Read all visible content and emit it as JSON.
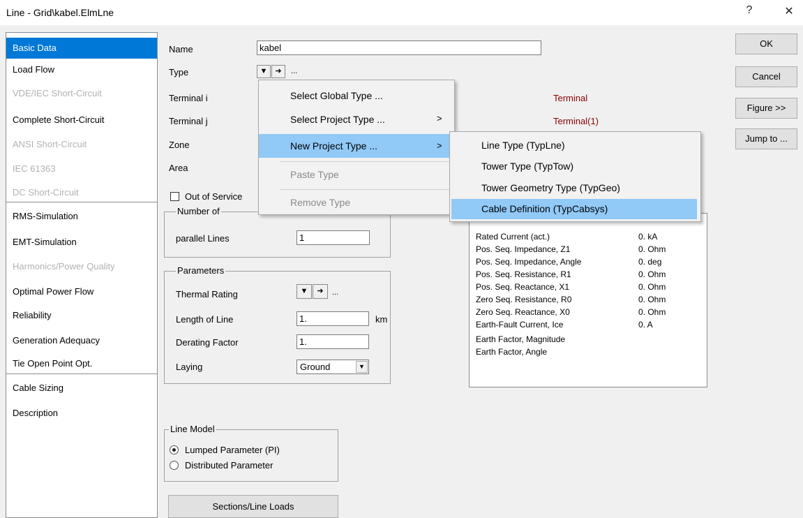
{
  "window": {
    "title": "Line - Grid\\kabel.ElmLne",
    "help_glyph": "?",
    "close_glyph": "✕"
  },
  "sidebar": {
    "items": [
      {
        "label": "Basic Data"
      },
      {
        "label": "Load Flow"
      },
      {
        "label": "VDE/IEC Short-Circuit"
      },
      {
        "label": "Complete Short-Circuit"
      },
      {
        "label": "ANSI Short-Circuit"
      },
      {
        "label": "IEC 61363"
      },
      {
        "label": "DC Short-Circuit"
      },
      {
        "label": "RMS-Simulation"
      },
      {
        "label": "EMT-Simulation"
      },
      {
        "label": "Harmonics/Power Quality"
      },
      {
        "label": "Optimal Power Flow"
      },
      {
        "label": "Reliability"
      },
      {
        "label": "Generation Adequacy"
      },
      {
        "label": "Tie Open Point Opt."
      },
      {
        "label": "Cable Sizing"
      },
      {
        "label": "Description"
      }
    ]
  },
  "form": {
    "name_label": "Name",
    "name_value": "kabel",
    "type_label": "Type",
    "terminal_i_label": "Terminal i",
    "terminal_j_label": "Terminal j",
    "zone_label": "Zone",
    "area_label": "Area",
    "terminal_i_value": "Terminal",
    "terminal_j_value": "Terminal(1)",
    "out_of_service_label": "Out of Service",
    "ellipsis": "...",
    "number_of_group": "Number of",
    "parallel_lines_label": "parallel Lines",
    "parallel_lines_value": "1",
    "parameters_group": "Parameters",
    "thermal_rating_label": "Thermal Rating",
    "length_label": "Length of Line",
    "length_value": "1.",
    "length_unit": "km",
    "derating_label": "Derating Factor",
    "derating_value": "1.",
    "laying_label": "Laying",
    "laying_value": "Ground",
    "line_model_group": "Line Model",
    "lumped_label": "Lumped Parameter (PI)",
    "distributed_label": "Distributed Parameter",
    "sections_button": "Sections/Line Loads"
  },
  "buttons": {
    "ok": "OK",
    "cancel": "Cancel",
    "figure": "Figure >>",
    "jump": "Jump to ..."
  },
  "context_menu": {
    "select_global": "Select Global Type ...",
    "select_project": "Select Project Type ...",
    "new_project": "New Project Type ...",
    "paste": "Paste Type",
    "remove": "Remove Type",
    "submenu_arrow": ">"
  },
  "submenu": {
    "line_type": "Line Type (TypLne)",
    "tower_type": "Tower Type (TypTow)",
    "tower_geometry": "Tower Geometry Type (TypGeo)",
    "cable_definition": "Cable Definition (TypCabsys)"
  },
  "results": [
    {
      "label": "Rated Current (act.)",
      "value": "0. kA"
    },
    {
      "label": "Pos. Seq. Impedance, Z1",
      "value": "0. Ohm"
    },
    {
      "label": "Pos. Seq. Impedance, Angle",
      "value": "0. deg"
    },
    {
      "label": "Pos. Seq. Resistance, R1",
      "value": "0. Ohm"
    },
    {
      "label": "Pos. Seq. Reactance, X1",
      "value": "0. Ohm"
    },
    {
      "label": "Zero Seq. Resistance, R0",
      "value": "0. Ohm"
    },
    {
      "label": "Zero Seq. Reactance, X0",
      "value": "0. Ohm"
    },
    {
      "label": "Earth-Fault Current, Ice",
      "value": "0. A"
    },
    {
      "label": "Earth Factor, Magnitude",
      "value": ""
    },
    {
      "label": "Earth Factor, Angle",
      "value": ""
    }
  ],
  "colors": {
    "selection_blue": "#0078d7",
    "menu_highlight": "#91c9f7",
    "terminal_text": "#8b0000"
  }
}
